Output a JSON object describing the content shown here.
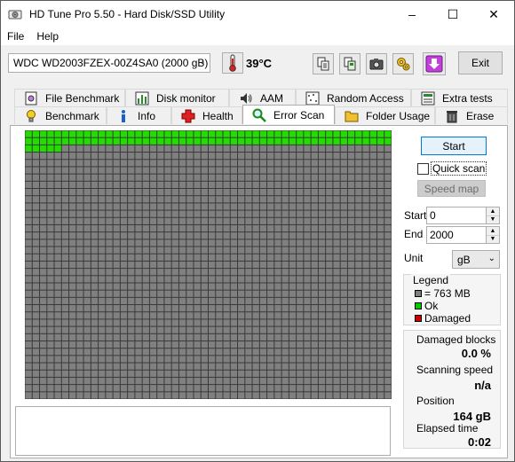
{
  "window": {
    "title": "HD Tune Pro 5.50 - Hard Disk/SSD Utility",
    "controls": [
      "–",
      "☐",
      "✕"
    ]
  },
  "menu": [
    "File",
    "Help"
  ],
  "toolbar": {
    "drive": "WDC WD2003FZEX-00Z4SA0 (2000 gB)",
    "temperature": "39°C",
    "exit_label": "Exit"
  },
  "tabs_top": [
    "File Benchmark",
    "Disk monitor",
    "AAM",
    "Random Access",
    "Extra tests"
  ],
  "tabs_bottom": [
    "Benchmark",
    "Info",
    "Health",
    "Error Scan",
    "Folder Usage",
    "Erase"
  ],
  "active_tab": "Error Scan",
  "scan": {
    "start_label": "Start",
    "quick_scan_label": "Quick scan",
    "quick_scan_checked": false,
    "speed_map_label": "Speed map",
    "start_field_label": "Start",
    "start_value": "0",
    "end_field_label": "End",
    "end_value": "2000",
    "unit_label": "Unit",
    "unit_value": "gB",
    "grid": {
      "columns": 50,
      "rows": 37,
      "ok_blocks": 105
    }
  },
  "legend": {
    "title": "Legend",
    "items": [
      {
        "label": "= 763 MB",
        "color": "#808080"
      },
      {
        "label": "Ok",
        "color": "#00cc00"
      },
      {
        "label": "Damaged",
        "color": "#cc0000"
      }
    ]
  },
  "stats": {
    "damaged_label": "Damaged blocks",
    "damaged_value": "0.0 %",
    "speed_label": "Scanning speed",
    "speed_value": "n/a",
    "position_label": "Position",
    "position_value": "164 gB",
    "elapsed_label": "Elapsed time",
    "elapsed_value": "0:02"
  },
  "colors": {
    "ok": "#22dd00",
    "unscanned": "#808080",
    "grid_line": "#3a3a3a",
    "accent": "#0078d7"
  }
}
